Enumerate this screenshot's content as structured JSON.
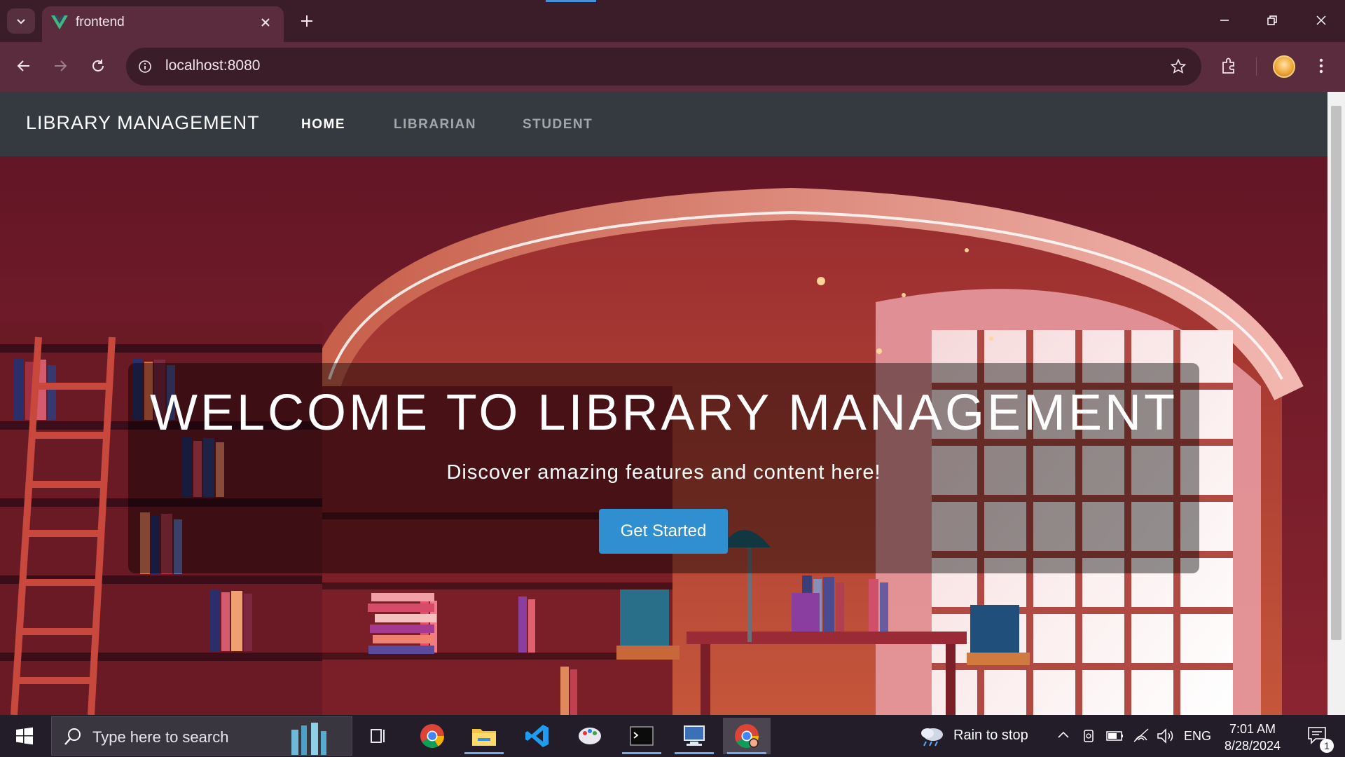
{
  "browser": {
    "tab": {
      "title": "frontend",
      "favicon": "vue-logo-icon"
    },
    "address": {
      "url": "localhost:8080"
    },
    "accent_color": "#5a2c3d"
  },
  "page": {
    "navbar": {
      "brand": "LIBRARY MANAGEMENT",
      "links": [
        {
          "label": "HOME",
          "active": true
        },
        {
          "label": "LIBRARIAN",
          "active": false
        },
        {
          "label": "STUDENT",
          "active": false
        }
      ]
    },
    "hero": {
      "title": "WELCOME TO LIBRARY MANAGEMENT",
      "subtitle": "Discover amazing features and content here!",
      "cta_label": "Get Started",
      "cta_color": "#2f8fd0"
    }
  },
  "taskbar": {
    "search_placeholder": "Type here to search",
    "apps": [
      "task-view-icon",
      "chrome-icon",
      "file-explorer-icon",
      "vscode-icon",
      "paint-icon",
      "terminal-icon",
      "network-app-icon",
      "chrome-active-icon"
    ],
    "weather": "Rain to stop",
    "language": "ENG",
    "time": "7:01 AM",
    "date": "8/28/2024",
    "notification_count": "1"
  }
}
